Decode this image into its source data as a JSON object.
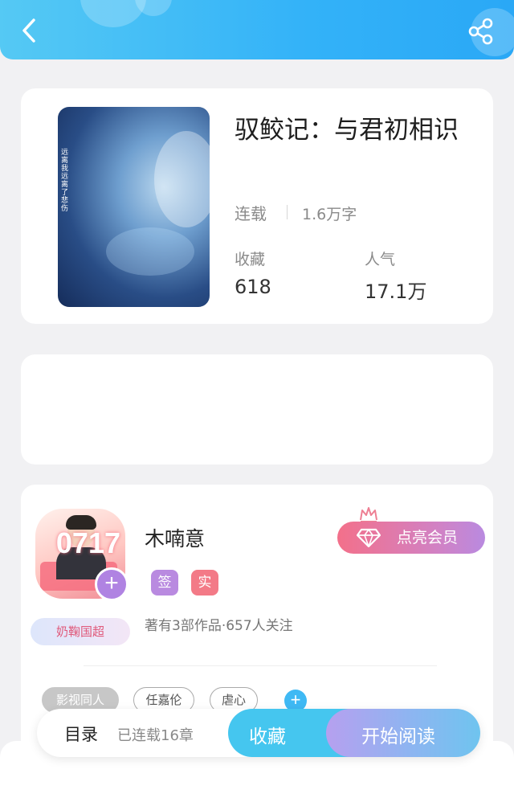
{
  "header": {
    "back_icon": "chevron-left-icon",
    "share_icon": "share-icon",
    "gradient_from": "#55c9f4",
    "gradient_to": "#2aa8f6"
  },
  "book": {
    "title": "驭鲛记：与君初相识",
    "cover_text": "远离我远离了悲伤",
    "status": "连载",
    "word_count": "1.6万字",
    "favorites_label": "收藏",
    "favorites_value": "618",
    "popularity_label": "人气",
    "popularity_value": "17.1万"
  },
  "author": {
    "name": "木喃意",
    "avatar_badge_number": "0717",
    "fan_badge": "奶鞠国超",
    "tag_signed": "签",
    "tag_verified": "实",
    "meta": "著有3部作品·657人关注",
    "vip_button": "点亮会员",
    "vip_icon": "diamond-icon",
    "crown_icon": "crown-icon",
    "follow_icon": "plus-icon"
  },
  "genre_tags": [
    "影视同人",
    "任嘉伦",
    "虐心"
  ],
  "add_tag_icon": "plus-icon",
  "bottom_bar": {
    "toc": "目录",
    "chapters": "已连载16章",
    "favorite": "收藏",
    "start_reading": "开始阅读"
  },
  "colors": {
    "accent_blue": "#45c6ef",
    "vip_pink": "#f3708a",
    "vip_purple": "#b98ae0",
    "tag_signed": "#b98ae0",
    "tag_verified": "#f37a87"
  }
}
